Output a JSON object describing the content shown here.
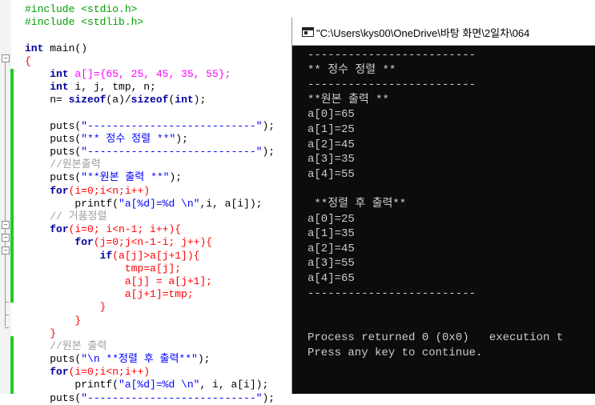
{
  "editor": {
    "lines": [
      [
        {
          "t": "#include <stdio.h>",
          "c": "pp"
        }
      ],
      [
        {
          "t": "#include <stdlib.h>",
          "c": "pp"
        }
      ],
      [],
      [
        {
          "t": "int",
          "c": "kw"
        },
        {
          "t": " main()",
          "c": "fn"
        }
      ],
      [
        {
          "t": "{",
          "c": "op"
        }
      ],
      [
        {
          "t": "    "
        },
        {
          "t": "int",
          "c": "kw"
        },
        {
          "t": " a[]={65, 25, 45, 35, 55};",
          "c": "num"
        }
      ],
      [
        {
          "t": "    "
        },
        {
          "t": "int",
          "c": "kw"
        },
        {
          "t": " i, j, tmp, n;",
          "c": "fn"
        }
      ],
      [
        {
          "t": "    n= "
        },
        {
          "t": "sizeof",
          "c": "kw"
        },
        {
          "t": "(a)/"
        },
        {
          "t": "sizeof",
          "c": "kw"
        },
        {
          "t": "("
        },
        {
          "t": "int",
          "c": "kw"
        },
        {
          "t": ");"
        }
      ],
      [],
      [
        {
          "t": "    puts("
        },
        {
          "t": "\"---------------------------\"",
          "c": "str"
        },
        {
          "t": ");"
        }
      ],
      [
        {
          "t": "    puts("
        },
        {
          "t": "\"** 정수 정렬 **\"",
          "c": "str"
        },
        {
          "t": ");"
        }
      ],
      [
        {
          "t": "    puts("
        },
        {
          "t": "\"---------------------------\"",
          "c": "str"
        },
        {
          "t": ");"
        }
      ],
      [
        {
          "t": "    //원본출력",
          "c": "cm"
        }
      ],
      [
        {
          "t": "    puts("
        },
        {
          "t": "\"**원본 출력 **\"",
          "c": "str"
        },
        {
          "t": ");"
        }
      ],
      [
        {
          "t": "    "
        },
        {
          "t": "for",
          "c": "kw"
        },
        {
          "t": "(i=0;i<n;i++)",
          "c": "op"
        }
      ],
      [
        {
          "t": "        printf("
        },
        {
          "t": "\"a[%d]=%d \\n\"",
          "c": "str"
        },
        {
          "t": ",i, a[i]);"
        }
      ],
      [
        {
          "t": "    // 거품정렬",
          "c": "cm"
        }
      ],
      [
        {
          "t": "    "
        },
        {
          "t": "for",
          "c": "kw"
        },
        {
          "t": "(i=0; i<n-1; i++){",
          "c": "op"
        }
      ],
      [
        {
          "t": "        "
        },
        {
          "t": "for",
          "c": "kw"
        },
        {
          "t": "(j=0;j<n-1-i; j++){",
          "c": "op"
        }
      ],
      [
        {
          "t": "            "
        },
        {
          "t": "if",
          "c": "kw"
        },
        {
          "t": "(a[j]>a[j+1]){",
          "c": "op"
        }
      ],
      [
        {
          "t": "                tmp=a[j];",
          "c": "op"
        }
      ],
      [
        {
          "t": "                a[j] = a[j+1];",
          "c": "op"
        }
      ],
      [
        {
          "t": "                a[j+1]=tmp;",
          "c": "op"
        }
      ],
      [
        {
          "t": "            }",
          "c": "op"
        }
      ],
      [
        {
          "t": "        }",
          "c": "op"
        }
      ],
      [
        {
          "t": "    }",
          "c": "op"
        }
      ],
      [
        {
          "t": "    //원본 출력",
          "c": "cm"
        }
      ],
      [
        {
          "t": "    puts("
        },
        {
          "t": "\"\\n **정렬 후 출력**\"",
          "c": "str"
        },
        {
          "t": ");"
        }
      ],
      [
        {
          "t": "    "
        },
        {
          "t": "for",
          "c": "kw"
        },
        {
          "t": "(i=0;i<n;i++)",
          "c": "op"
        }
      ],
      [
        {
          "t": "        printf("
        },
        {
          "t": "\"a[%d]=%d \\n\"",
          "c": "str"
        },
        {
          "t": ", i, a[i]);"
        }
      ],
      [
        {
          "t": "    puts("
        },
        {
          "t": "\"---------------------------\"",
          "c": "str"
        },
        {
          "t": ");"
        }
      ]
    ]
  },
  "console": {
    "title": "\"C:\\Users\\kys00\\OneDrive\\바탕 화면\\2일차\\064",
    "lines": [
      "-------------------------",
      "** 정수 정렬 **",
      "-------------------------",
      "**원본 출력 **",
      "a[0]=65",
      "a[1]=25",
      "a[2]=45",
      "a[3]=35",
      "a[4]=55",
      "",
      " **정렬 후 출력**",
      "a[0]=25",
      "a[1]=35",
      "a[2]=45",
      "a[3]=55",
      "a[4]=65",
      "-------------------------",
      "",
      "",
      "Process returned 0 (0x0)   execution t",
      "Press any key to continue."
    ]
  }
}
